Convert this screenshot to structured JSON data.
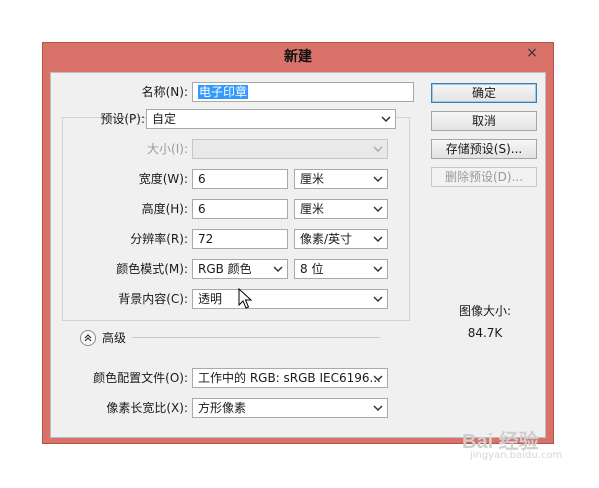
{
  "dialog": {
    "title": "新建",
    "close": "×"
  },
  "form": {
    "name": {
      "label": "名称(N):",
      "value": "电子印章"
    },
    "preset": {
      "label": "预设(P):",
      "value": "自定"
    },
    "size": {
      "label": "大小(I):",
      "value": ""
    },
    "width": {
      "label": "宽度(W):",
      "value": "6",
      "unit": "厘米"
    },
    "height": {
      "label": "高度(H):",
      "value": "6",
      "unit": "厘米"
    },
    "resolution": {
      "label": "分辨率(R):",
      "value": "72",
      "unit": "像素/英寸"
    },
    "color_mode": {
      "label": "颜色模式(M):",
      "value": "RGB 颜色",
      "depth": "8 位"
    },
    "background": {
      "label": "背景内容(C):",
      "value": "透明"
    },
    "advanced": {
      "label": "高级"
    },
    "color_profile": {
      "label": "颜色配置文件(O):",
      "value": "工作中的 RGB: sRGB IEC6196..."
    },
    "pixel_aspect": {
      "label": "像素长宽比(X):",
      "value": "方形像素"
    }
  },
  "buttons": {
    "ok": "确定",
    "cancel": "取消",
    "save_preset": "存储预设(S)...",
    "delete_preset": "删除预设(D)..."
  },
  "image_size": {
    "label": "图像大小:",
    "value": "84.7K"
  },
  "watermark": {
    "brand": "Bai 经验",
    "url": "jingyan.baidu.com"
  },
  "colors": {
    "frame": "#d9726a",
    "selection": "#3399ff",
    "client": "#f0f0f0"
  }
}
